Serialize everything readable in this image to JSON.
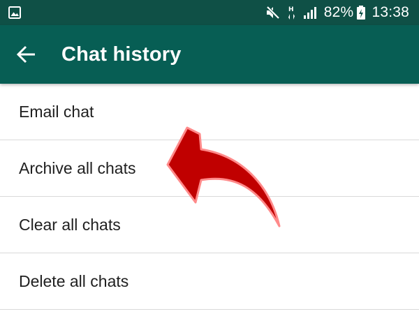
{
  "status_bar": {
    "left_icon": "image-notification-icon",
    "icons": [
      "mute-icon",
      "hspa-signal-icon",
      "cell-signal-icon"
    ],
    "battery_percent": "82%",
    "battery_icon": "battery-charging-icon",
    "time": "13:38"
  },
  "app_bar": {
    "back_icon": "arrow-back-icon",
    "title": "Chat history"
  },
  "menu": {
    "items": [
      {
        "label": "Email chat"
      },
      {
        "label": "Archive all chats"
      },
      {
        "label": "Clear all chats"
      },
      {
        "label": "Delete all chats"
      }
    ]
  },
  "colors": {
    "status_bar": "#0f5046",
    "app_bar": "#075e54",
    "divider": "#d9d9d9",
    "annotation_arrow": "#c00000"
  }
}
